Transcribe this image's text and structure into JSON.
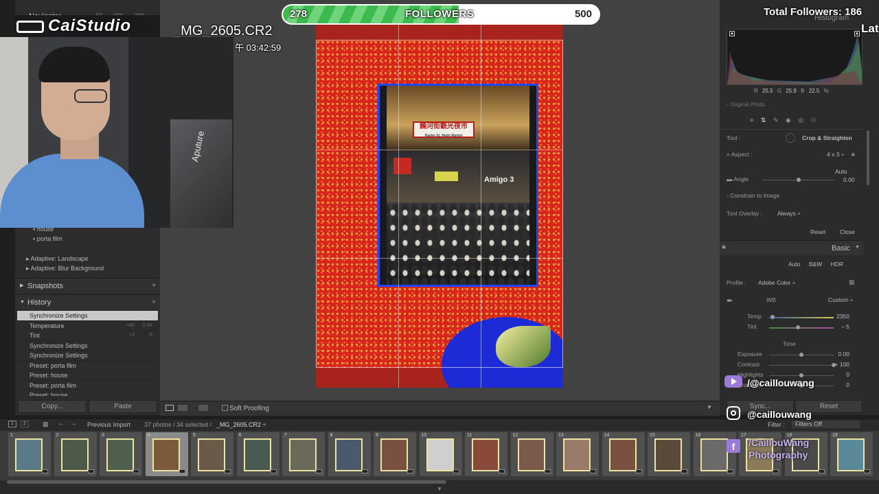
{
  "followers_bar": {
    "current": "278",
    "label": "FOLLOWERS",
    "goal": "500",
    "progress_fraction": 0.556
  },
  "overlay": {
    "total_followers": "Total Followers: 186",
    "latest_partial": "Lat",
    "logo_text": "CaiStudio",
    "file_name": "_MG_2605.CR2",
    "time": "午 03:42:59",
    "webcam_light_brand": "Aputure",
    "social": [
      {
        "icon": "youtube-icon",
        "handle": "/@caillouwang"
      },
      {
        "icon": "instagram-icon",
        "handle": "@caillouwang"
      },
      {
        "icon": "facebook-icon",
        "handle": "/CaillouWang Photography"
      }
    ]
  },
  "left_panel": {
    "navigator_title": "Navigator",
    "navigator_zoom": [
      "FIT",
      "100%",
      "200%"
    ],
    "presets": [
      "house",
      "porta film"
    ],
    "adaptive": [
      "Adaptive: Landscape",
      "Adaptive: Blur Background"
    ],
    "snapshots_title": "Snapshots",
    "snapshots_action": "+",
    "history_title": "History",
    "history_action": "×",
    "history": [
      {
        "label": "Synchronize Settings",
        "v1": "",
        "v2": "",
        "selected": true
      },
      {
        "label": "Temperature",
        "v1": "+90",
        "v2": "2.4K",
        "selected": false
      },
      {
        "label": "Tint",
        "v1": "+2",
        "v2": "-5",
        "selected": false
      },
      {
        "label": "Synchronize Settings",
        "v1": "",
        "v2": "",
        "selected": false
      },
      {
        "label": "Synchronize Settings",
        "v1": "",
        "v2": "",
        "selected": false
      },
      {
        "label": "Preset: porta film",
        "v1": "",
        "v2": "",
        "selected": false
      },
      {
        "label": "Preset: house",
        "v1": "",
        "v2": "",
        "selected": false
      },
      {
        "label": "Preset: porta film",
        "v1": "",
        "v2": "",
        "selected": false
      },
      {
        "label": "Preset: house",
        "v1": "",
        "v2": "",
        "selected": false
      }
    ],
    "copy_label": "Copy...",
    "paste_label": "Paste"
  },
  "center": {
    "soft_proofing": "Soft Proofing",
    "photo_sign_text": "饒河街觀光夜市",
    "photo_sign_sub": "Raohe St. Night Market",
    "photo_store_sign": "Amigo 3"
  },
  "right_panel": {
    "histogram_title": "Histogram",
    "rgb": {
      "r_label": "R",
      "r": "25.5",
      "g_label": "G",
      "g": "25.9",
      "b_label": "B",
      "b": "22.5",
      "unit": "%"
    },
    "original_photo": "Original Photo",
    "tool_label": "Tool :",
    "tool_value": "Crop & Straighten",
    "aspect_label": "Aspect :",
    "aspect_value": "4 x 3 ÷",
    "auto": "Auto",
    "angle_label": "Angle",
    "angle_value": "0.00",
    "angle_fraction": 0.5,
    "constrain": "Constrain to Image",
    "overlay_label": "Tool Overlay :",
    "overlay_value": "Always ÷",
    "reset": "Reset",
    "close": "Close",
    "basic_title": "Basic",
    "tabs": [
      "Auto",
      "B&W",
      "HDR"
    ],
    "profile_label": "Profile :",
    "profile_value": "Adobe Color ÷",
    "wb_label": "WB",
    "wb_value": "Custom ÷",
    "sliders": [
      {
        "label": "Temp",
        "value": "2350",
        "fraction": 0.05
      },
      {
        "label": "Tint",
        "value": "– 5",
        "fraction": 0.45
      }
    ],
    "tone_title": "Tone",
    "tone_sliders": [
      {
        "label": "Exposure",
        "value": "0.00",
        "fraction": 0.5
      },
      {
        "label": "Contrast",
        "value": "+ 100",
        "fraction": 1.0
      },
      {
        "label": "Highlights",
        "value": "0",
        "fraction": 0.5
      },
      {
        "label": "Shadows",
        "value": "0",
        "fraction": 0.5
      }
    ],
    "sync_label": "Sync...",
    "reset_label": "Reset"
  },
  "filmstrip": {
    "previous_import": "Previous Import",
    "count_text": "37 photos / 34 selected /",
    "current_file": "_MG_2605.CR2 ÷",
    "filter_label": "Filter :",
    "filter_value": "Filters Off",
    "thumbs": [
      {
        "num": "1"
      },
      {
        "num": "2"
      },
      {
        "num": "3"
      },
      {
        "num": "4"
      },
      {
        "num": "5"
      },
      {
        "num": "6"
      },
      {
        "num": "7"
      },
      {
        "num": "8"
      },
      {
        "num": "9"
      },
      {
        "num": "10"
      },
      {
        "num": "11"
      },
      {
        "num": "12"
      },
      {
        "num": "13"
      },
      {
        "num": "14"
      },
      {
        "num": "15"
      },
      {
        "num": "16"
      },
      {
        "num": "17"
      },
      {
        "num": "18"
      },
      {
        "num": "19"
      }
    ]
  }
}
